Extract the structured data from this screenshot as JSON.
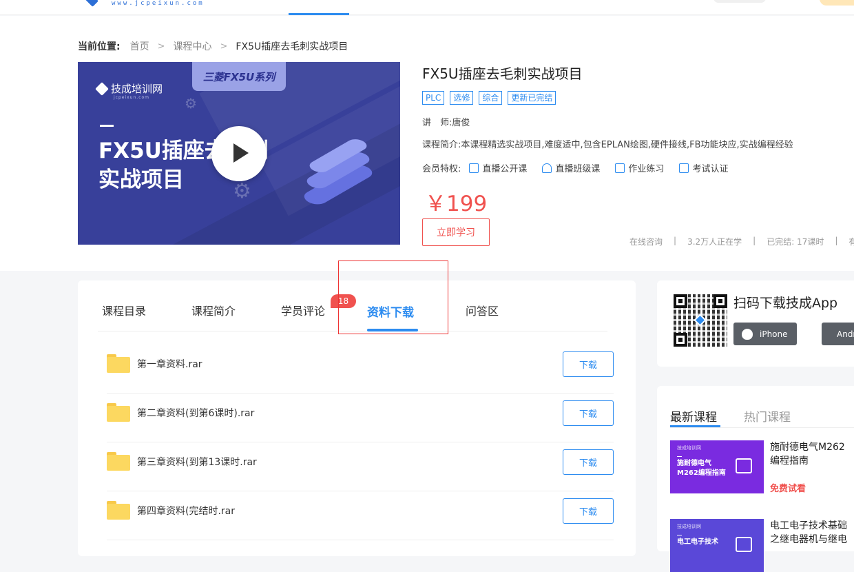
{
  "header": {
    "site_url": "www.jcpeixun.com"
  },
  "breadcrumb": {
    "label": "当前位置:",
    "items": [
      "首页",
      "课程中心"
    ],
    "current": "FX5U插座去毛刺实战项目"
  },
  "cover": {
    "logo_text": "技成培训网",
    "logo_sub": "jcpeixun.com",
    "series_badge": "三菱FX5U系列",
    "title": "FX5U插座去毛刺\n实战项目"
  },
  "course": {
    "title": "FX5U插座去毛刺实战项目",
    "tags": [
      "PLC",
      "选修",
      "综合",
      "更新已完结"
    ],
    "teacher": "讲　师:唐俊",
    "intro": "课程简介:本课程精选实战项目,难度适中,包含EPLAN绘图,硬件接线,FB功能块应,实战编程经验",
    "perks_label": "会员特权:",
    "perks": [
      {
        "icon": "live-icon",
        "label": "直播公开课"
      },
      {
        "icon": "headset-icon",
        "label": "直播班级课"
      },
      {
        "icon": "edit-icon",
        "label": "作业练习"
      },
      {
        "icon": "certificate-icon",
        "label": "考试认证"
      }
    ],
    "price": "￥199",
    "study_button": "立即学习",
    "stats": [
      "在线咨询",
      "3.2万人正在学",
      "已完结: 17课时",
      "有效"
    ]
  },
  "tabs": {
    "items": [
      "课程目录",
      "课程简介",
      "学员评论",
      "资料下载",
      "问答区"
    ],
    "active": "资料下载",
    "comment_badge": "18"
  },
  "files": [
    {
      "name": "第一章资料.rar",
      "button": "下载"
    },
    {
      "name": "第二章资料(到第6课时).rar",
      "button": "下载"
    },
    {
      "name": "第三章资料(到第13课时.rar",
      "button": "下载"
    },
    {
      "name": "第四章资料(完结时.rar",
      "button": "下载"
    }
  ],
  "app_download": {
    "title": "扫码下载技成App",
    "buttons": [
      "iPhone",
      "Android"
    ]
  },
  "course_list": {
    "tabs": [
      "最新课程",
      "热门课程"
    ],
    "active": "最新课程",
    "items": [
      {
        "thumb_title": "施耐德电气\nM262编程指南",
        "thumb_logo": "技成培训网",
        "name": "施耐德电气M262编程指南",
        "label": "免费试看"
      },
      {
        "thumb_title": "电工电子技术",
        "thumb_logo": "技成培训网",
        "name": "电工电子技术基础之继电器机与继电接触控制篇",
        "label": ""
      }
    ]
  },
  "colors": {
    "accent": "#2d8cf0",
    "price": "#f0524f",
    "cover_bg": "#38409a",
    "thumb_bg": "#7a2be0"
  }
}
